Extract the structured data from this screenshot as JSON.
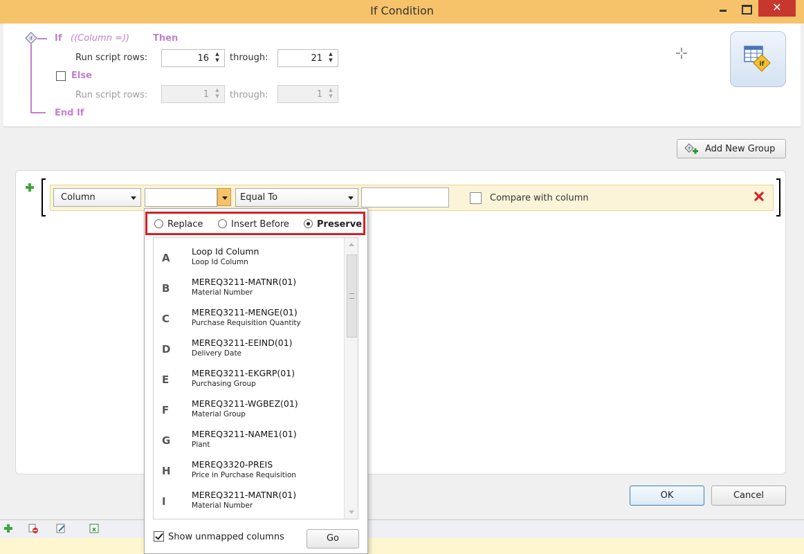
{
  "window": {
    "title": "If Condition",
    "close_glyph": "✕"
  },
  "condition_block": {
    "if_label": "If",
    "condition_text": "((Column =))",
    "then_label": "Then",
    "run_rows_label": "Run script rows:",
    "then_from": "16",
    "through_label": "through:",
    "then_to": "21",
    "else_label": "Else",
    "else_checked": false,
    "else_from": "1",
    "else_to": "1",
    "end_if_label": "End If"
  },
  "toolbar": {
    "add_new_group_label": "Add New Group"
  },
  "condition_row": {
    "field_type": "Column",
    "column_value": "",
    "operator": "Equal To",
    "compare_value": "",
    "compare_with_column_label": "Compare with column",
    "compare_with_column_checked": false
  },
  "column_popup": {
    "modes": [
      {
        "label": "Replace",
        "selected": false
      },
      {
        "label": "Insert Before",
        "selected": false
      },
      {
        "label": "Preserve",
        "selected": true
      }
    ],
    "items": [
      {
        "letter": "A",
        "name": "Loop Id Column",
        "desc": "Loop Id Column"
      },
      {
        "letter": "B",
        "name": "MEREQ3211-MATNR(01)",
        "desc": "Material Number"
      },
      {
        "letter": "C",
        "name": "MEREQ3211-MENGE(01)",
        "desc": "Purchase Requisition Quantity"
      },
      {
        "letter": "D",
        "name": "MEREQ3211-EEIND(01)",
        "desc": "Delivery Date"
      },
      {
        "letter": "E",
        "name": "MEREQ3211-EKGRP(01)",
        "desc": "Purchasing Group"
      },
      {
        "letter": "F",
        "name": "MEREQ3211-WGBEZ(01)",
        "desc": "Material Group"
      },
      {
        "letter": "G",
        "name": "MEREQ3211-NAME1(01)",
        "desc": "Plant"
      },
      {
        "letter": "H",
        "name": "MEREQ3320-PREIS",
        "desc": "Price in Purchase Requisition"
      },
      {
        "letter": "I",
        "name": "MEREQ3211-MATNR(01)",
        "desc": "Material Number"
      }
    ],
    "show_unmapped_label": "Show unmapped columns",
    "show_unmapped_checked": true,
    "go_label": "Go"
  },
  "dialog_buttons": {
    "ok_label": "OK",
    "cancel_label": "Cancel"
  },
  "colors": {
    "title_bar": "#f6c36a",
    "keyword_purple": "#c27fd0",
    "close_red": "#c7372f",
    "highlight_red": "#d61f26",
    "row_yellow": "#fbf4d8"
  }
}
